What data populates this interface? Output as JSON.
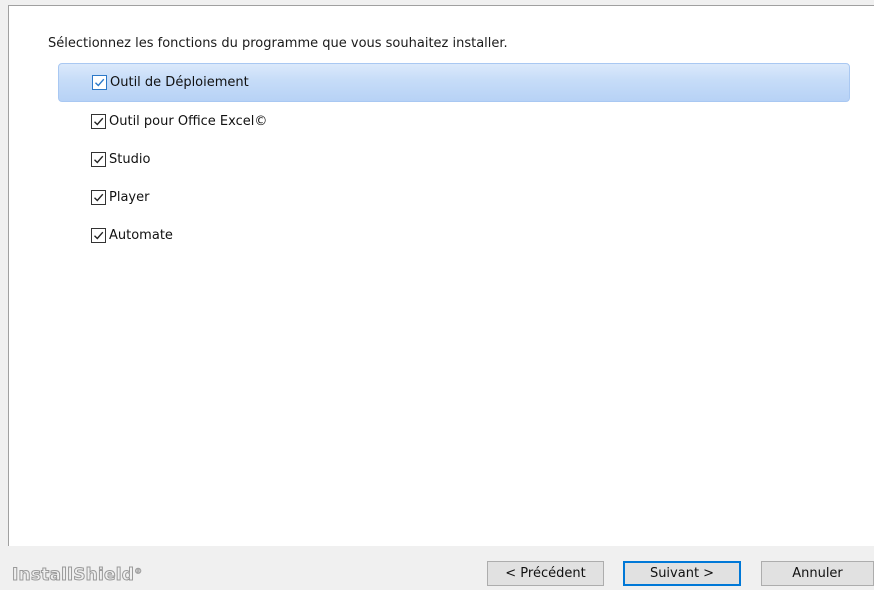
{
  "instruction": "Sélectionnez les fonctions du programme que vous souhaitez installer.",
  "features": [
    {
      "label": "Outil de Déploiement",
      "checked": true,
      "selected": true
    },
    {
      "label": "Outil pour Office Excel©",
      "checked": true,
      "selected": false
    },
    {
      "label": "Studio",
      "checked": true,
      "selected": false
    },
    {
      "label": "Player",
      "checked": true,
      "selected": false
    },
    {
      "label": "Automate",
      "checked": true,
      "selected": false
    }
  ],
  "branding": {
    "name": "InstallShield",
    "trademark": "®"
  },
  "buttons": {
    "back": "< Précédent",
    "next": "Suivant >",
    "cancel": "Annuler"
  },
  "colors": {
    "selection": "#c6dcf8",
    "focus_border": "#0078d7",
    "checkmark": "#2b78c8"
  }
}
